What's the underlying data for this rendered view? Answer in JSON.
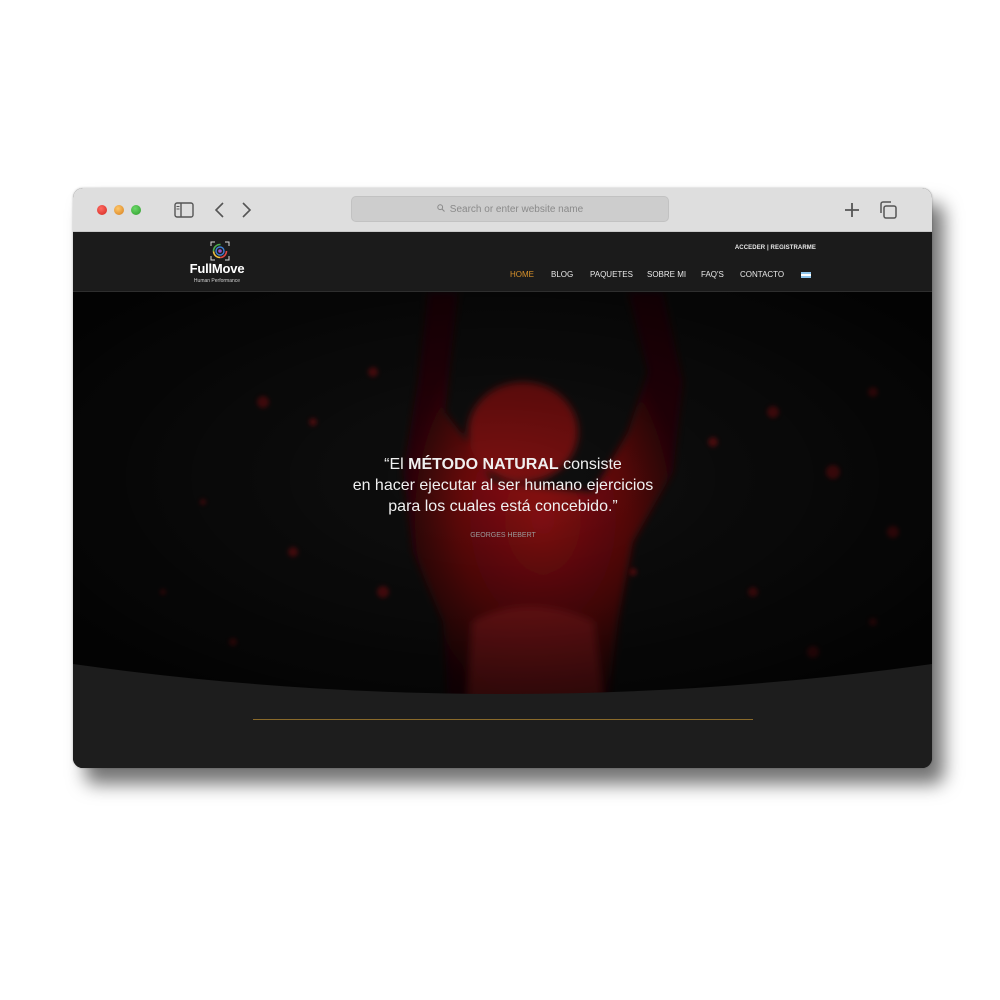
{
  "browser": {
    "address_placeholder": "Search or enter website name",
    "icons": [
      "sidebar-icon",
      "back-chevron-icon",
      "forward-chevron-icon",
      "search-icon",
      "plus-icon",
      "tabs-icon"
    ]
  },
  "site": {
    "logo": {
      "name": "FullMove",
      "tagline": "Human Performance"
    },
    "account_links": "ACCEDER | REGISTRARME",
    "nav": [
      {
        "label": "HOME",
        "active": true
      },
      {
        "label": "BLOG",
        "active": false
      },
      {
        "label": "PAQUETES",
        "active": false
      },
      {
        "label": "SOBRE MI",
        "active": false
      },
      {
        "label": "FAQ'S",
        "active": false
      },
      {
        "label": "CONTACTO",
        "active": false
      }
    ],
    "language_flag": "argentina-flag-icon",
    "accent_color": "#d8922b"
  },
  "hero": {
    "quote": {
      "open": "“El ",
      "emphasis": "MÉTODO NATURAL",
      "line1_rest": " consiste",
      "line2": "en hacer ejecutar al ser humano ejercicios",
      "line3": "para los cuales está concebido.”"
    },
    "author": "GEORGES HEBERT"
  }
}
